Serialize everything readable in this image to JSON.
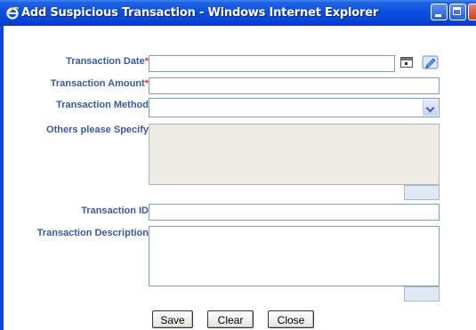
{
  "window": {
    "title": "Add Suspicious Transaction - Windows Internet Explorer"
  },
  "form": {
    "transaction_date": {
      "label": "Transaction Date",
      "required_mark": "*",
      "value": ""
    },
    "transaction_amount": {
      "label": "Transaction Amount",
      "required_mark": "*",
      "value": ""
    },
    "transaction_method": {
      "label": "Transaction Method",
      "value": ""
    },
    "others_specify": {
      "label": "Others please Specify",
      "value": ""
    },
    "transaction_id": {
      "label": "Transaction ID",
      "value": ""
    },
    "transaction_description": {
      "label": "Transaction Description",
      "value": ""
    }
  },
  "buttons": {
    "save": "Save",
    "clear": "Clear",
    "close": "Close"
  },
  "icons": {
    "browser": "internet-explorer-icon",
    "calendar": "calendar-icon",
    "edit": "edit-pencil-icon"
  },
  "colors": {
    "titlebar": "#0a50e0",
    "label": "#3a5aa0",
    "required": "#e0303a",
    "disabled_field": "#ecece4"
  }
}
